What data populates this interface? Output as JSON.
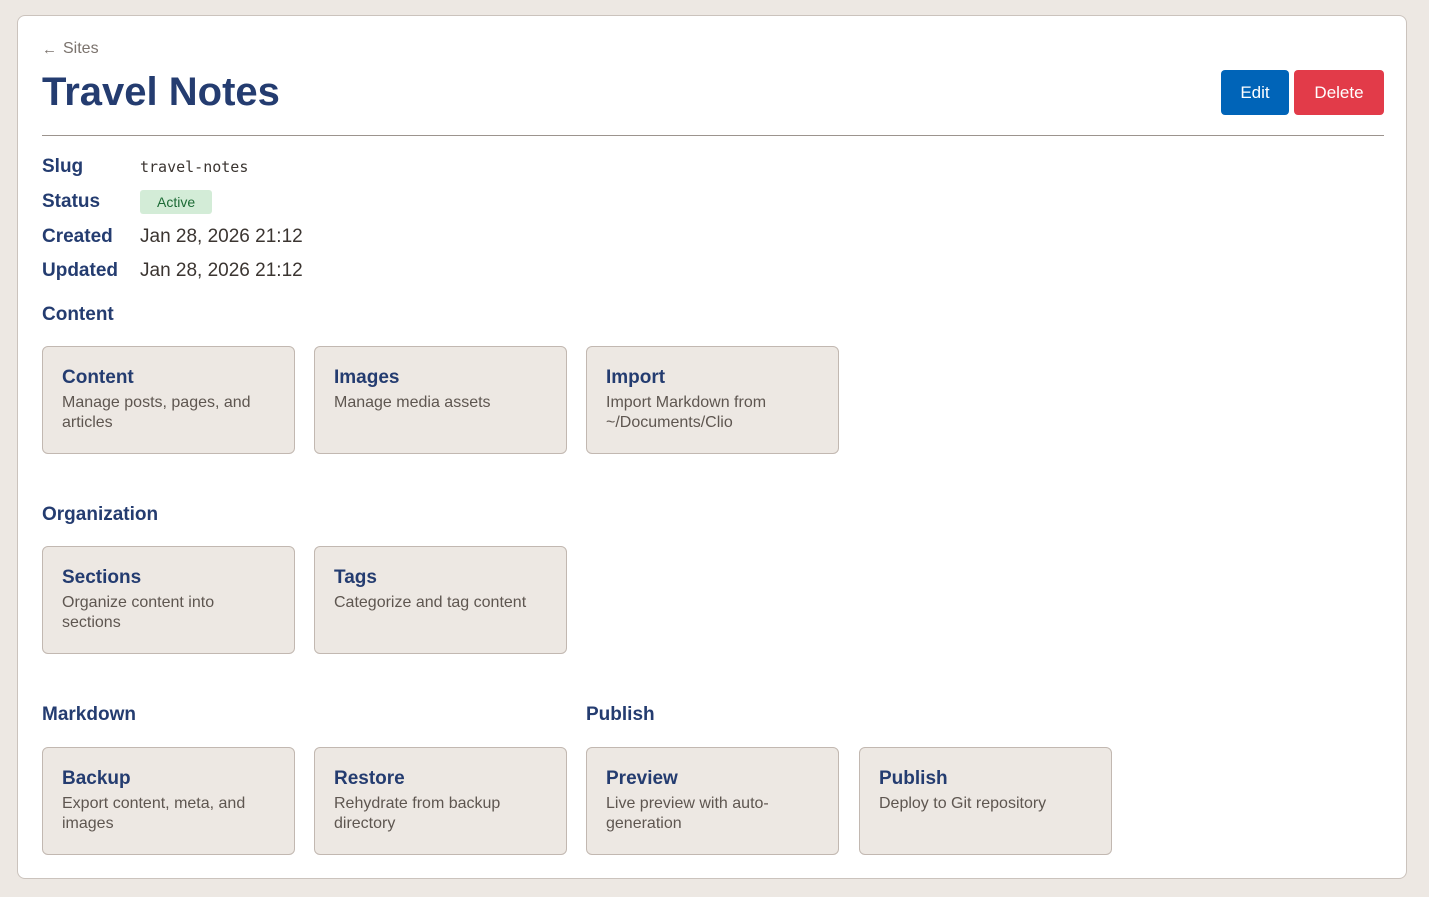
{
  "nav": {
    "back_arrow": "←",
    "back_label": "Sites"
  },
  "page": {
    "title": "Travel Notes"
  },
  "actions": {
    "edit_label": "Edit",
    "delete_label": "Delete"
  },
  "details": {
    "slug_label": "Slug",
    "slug_value": "travel-notes",
    "status_label": "Status",
    "status_value": "Active",
    "created_label": "Created",
    "created_value": "Jan 28, 2026 21:12",
    "updated_label": "Updated",
    "updated_value": "Jan 28, 2026 21:12"
  },
  "sections": {
    "content": {
      "heading": "Content",
      "cards": [
        {
          "title": "Content",
          "description": "Manage posts, pages, and articles"
        },
        {
          "title": "Images",
          "description": "Manage media assets"
        },
        {
          "title": "Import",
          "description": "Import Markdown from ~/Documents/Clio"
        }
      ]
    },
    "organization": {
      "heading": "Organization",
      "cards": [
        {
          "title": "Sections",
          "description": "Organize content into sections"
        },
        {
          "title": "Tags",
          "description": "Categorize and tag content"
        }
      ]
    },
    "markdown": {
      "heading": "Markdown",
      "cards": [
        {
          "title": "Backup",
          "description": "Export content, meta, and images"
        },
        {
          "title": "Restore",
          "description": "Rehydrate from backup directory"
        }
      ]
    },
    "publish": {
      "heading": "Publish",
      "cards": [
        {
          "title": "Preview",
          "description": "Live preview with auto-generation"
        },
        {
          "title": "Publish",
          "description": "Deploy to Git repository"
        }
      ]
    }
  },
  "colors": {
    "page_background": "#ede8e3",
    "heading": "#243c70",
    "edit_button": "#0064b8",
    "delete_button": "#e23b49",
    "status_badge_bg": "#d3ecd7",
    "status_badge_text": "#1d6b36"
  },
  "icons": {
    "back": "arrow-left-icon"
  }
}
